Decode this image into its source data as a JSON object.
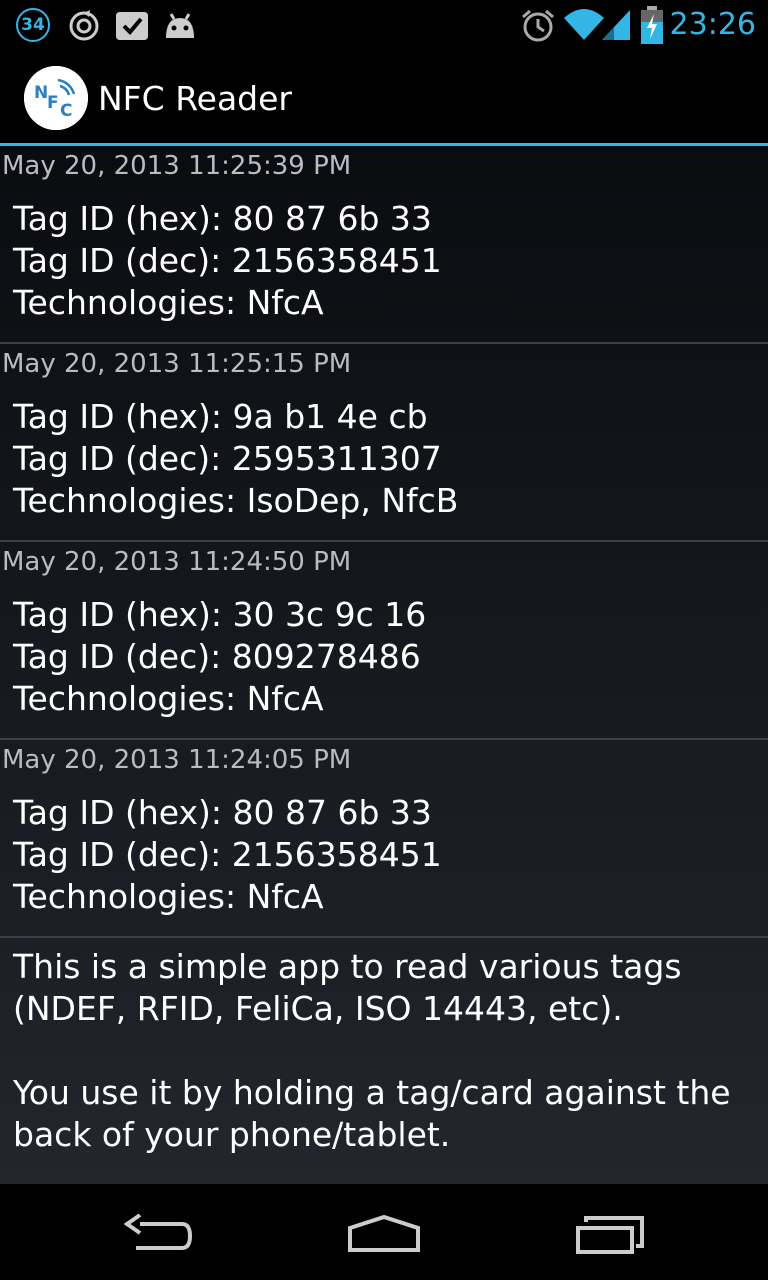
{
  "status_bar": {
    "notification_count": "34",
    "time": "23:26",
    "icons": [
      "notification-count-icon",
      "sync-icon",
      "todo-check-icon",
      "android-icon",
      "alarm-icon",
      "wifi-icon",
      "signal-icon",
      "battery-charging-icon"
    ]
  },
  "action_bar": {
    "title": "NFC Reader",
    "logo_icon": "nfc-logo-icon"
  },
  "entries": [
    {
      "date": "May 20, 2013 11:25:39 PM",
      "hex": "Tag ID (hex): 80 87 6b 33",
      "dec": "Tag ID (dec): 2156358451",
      "tech": "Technologies: NfcA"
    },
    {
      "date": "May 20, 2013 11:25:15 PM",
      "hex": "Tag ID (hex): 9a b1 4e cb",
      "dec": "Tag ID (dec): 2595311307",
      "tech": "Technologies: IsoDep, NfcB"
    },
    {
      "date": "May 20, 2013 11:24:50 PM",
      "hex": "Tag ID (hex): 30 3c 9c 16",
      "dec": "Tag ID (dec): 809278486",
      "tech": "Technologies: NfcA"
    },
    {
      "date": "May 20, 2013 11:24:05 PM",
      "hex": "Tag ID (hex): 80 87 6b 33",
      "dec": "Tag ID (dec): 2156358451",
      "tech": "Technologies: NfcA"
    }
  ],
  "info": {
    "paragraph1": "This is a simple app to read various tags (NDEF, RFID, FeliCa, ISO 14443, etc).",
    "paragraph2": "You use it by holding a tag/card against the back of your phone/tablet."
  },
  "nav_bar": {
    "icons": [
      "back-icon",
      "home-icon",
      "recent-apps-icon"
    ]
  },
  "colors": {
    "accent": "#33b5e5",
    "background": "#000000",
    "divider": "#3b3f45"
  }
}
